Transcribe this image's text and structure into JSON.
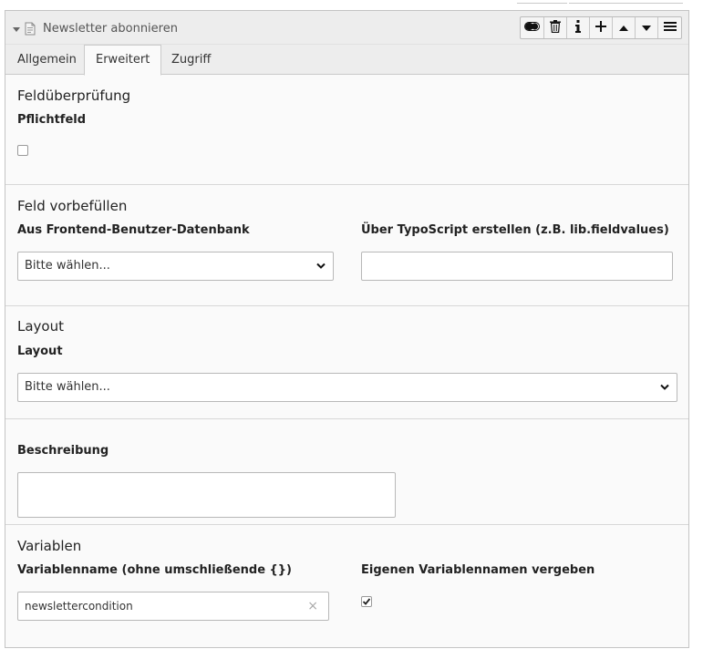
{
  "header": {
    "title": "Newsletter abonnieren",
    "buttons": [
      "toggle-icon",
      "trash-icon",
      "info-icon",
      "plus-icon",
      "arrow-up-icon",
      "arrow-down-icon",
      "menu-icon"
    ]
  },
  "tabs": [
    {
      "label": "Allgemein",
      "active": false
    },
    {
      "label": "Erweitert",
      "active": true
    },
    {
      "label": "Zugriff",
      "active": false
    }
  ],
  "validation": {
    "title": "Feldüberprüfung",
    "required_label": "Pflichtfeld",
    "required_checked": false
  },
  "prefill": {
    "title": "Feld vorbefüllen",
    "frontend_label": "Aus Frontend-Benutzer-Datenbank",
    "frontend_value": "Bitte wählen...",
    "typoscript_label": "Über TypoScript erstellen (z.B. lib.fieldvalues)",
    "typoscript_value": ""
  },
  "layout": {
    "title": "Layout",
    "layout_label": "Layout",
    "layout_value": "Bitte wählen..."
  },
  "description": {
    "label": "Beschreibung",
    "value": ""
  },
  "variables": {
    "title": "Variablen",
    "name_label": "Variablenname (ohne umschließende {})",
    "name_value": "newslettercondition",
    "custom_label": "Eigenen Variablennamen vergeben",
    "custom_checked": true
  },
  "colors": {
    "header_bg": "#ededed",
    "panel_bg": "#fafafa",
    "border": "#c4c4c4"
  }
}
